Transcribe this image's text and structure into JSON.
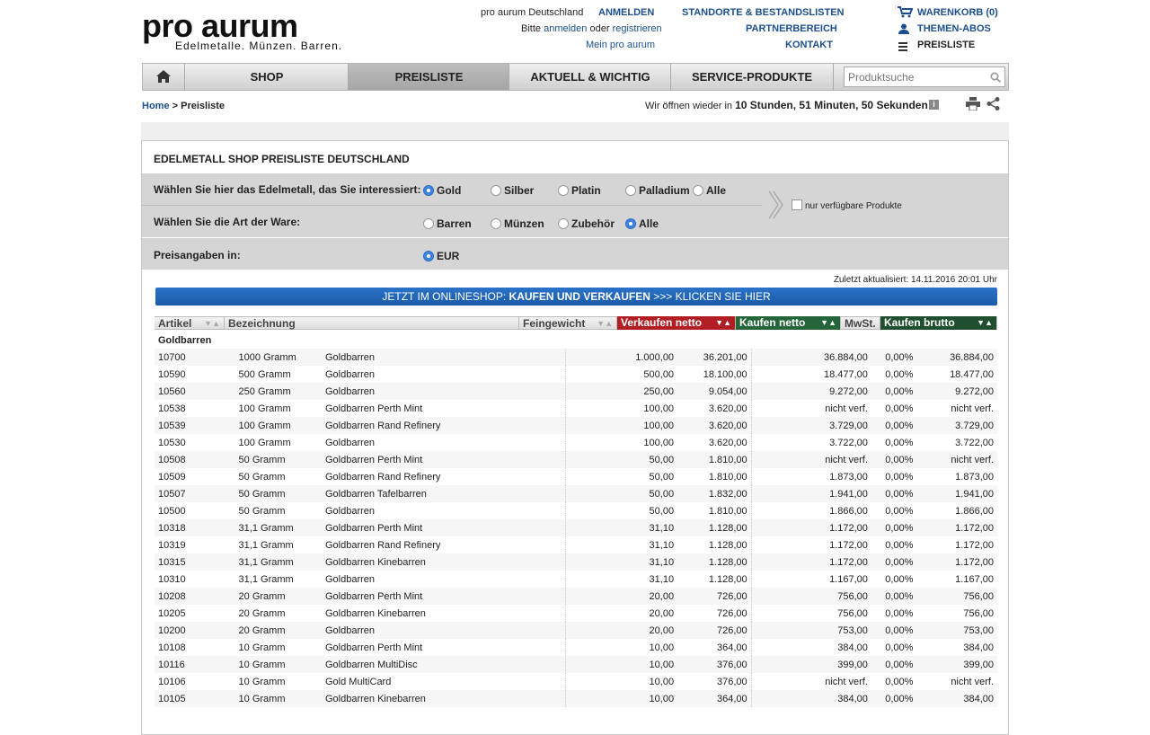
{
  "logo": {
    "title": "pro aurum",
    "subtitle": "Edelmetalle. Münzen. Barren."
  },
  "top": {
    "country": "pro aurum Deutschland",
    "login": "ANMELDEN",
    "bitte": "Bitte",
    "anmelden": "anmelden",
    "oder": "oder",
    "registrieren": "registrieren",
    "mein": "Mein pro aurum",
    "standorte": "STANDORTE & BESTANDSLISTEN",
    "partner": "PARTNERBEREICH",
    "kontakt": "KONTAKT",
    "warenkorb": "WARENKORB (0)",
    "abos": "THEMEN-ABOS",
    "preisliste": "PREISLISTE"
  },
  "nav": {
    "shop": "SHOP",
    "preisliste": "PREISLISTE",
    "aktuell": "AKTUELL & WICHTIG",
    "service": "SERVICE-PRODUKTE",
    "search_placeholder": "Produktsuche"
  },
  "breadcrumb": {
    "home": "Home",
    "sep": ">",
    "current": "Preisliste"
  },
  "opening": {
    "prefix": "Wir öffnen wieder in",
    "time": "10 Stunden, 51 Minuten, 50 Sekunden",
    "suffix": "."
  },
  "panel": {
    "title": "EDELMETALL SHOP PREISLISTE DEUTSCHLAND",
    "metal_label": "Wählen Sie hier das Edelmetall, das Sie interessiert:",
    "metals": [
      "Gold",
      "Silber",
      "Platin",
      "Palladium",
      "Alle"
    ],
    "type_label": "Wählen Sie die Art der Ware:",
    "types": [
      "Barren",
      "Münzen",
      "Zubehör",
      "Alle"
    ],
    "available": "nur verfügbare Produkte",
    "currency_label": "Preisangaben in:",
    "currency": "EUR",
    "updated": "Zuletzt aktualisiert: 14.11.2016 20:01 Uhr",
    "cta_prefix": "JETZT IM ONLINESHOP:",
    "cta_bold": "KAUFEN UND VERKAUFEN",
    "cta_suffix": ">>> KLICKEN SIE HIER"
  },
  "table": {
    "headers": [
      "Artikel",
      "Bezeichnung",
      "Feingewicht",
      "Verkaufen netto",
      "Kaufen netto",
      "MwSt.",
      "Kaufen brutto"
    ],
    "group": "Goldbarren",
    "rows": [
      [
        "10700",
        "1000 Gramm",
        "Goldbarren",
        "1.000,00",
        "36.201,00",
        "36.884,00",
        "0,00%",
        "36.884,00"
      ],
      [
        "10590",
        "500 Gramm",
        "Goldbarren",
        "500,00",
        "18.100,00",
        "18.477,00",
        "0,00%",
        "18.477,00"
      ],
      [
        "10560",
        "250 Gramm",
        "Goldbarren",
        "250,00",
        "9.054,00",
        "9.272,00",
        "0,00%",
        "9.272,00"
      ],
      [
        "10538",
        "100 Gramm",
        "Goldbarren Perth Mint",
        "100,00",
        "3.620,00",
        "nicht verf.",
        "0,00%",
        "nicht verf."
      ],
      [
        "10539",
        "100 Gramm",
        "Goldbarren Rand Refinery",
        "100,00",
        "3.620,00",
        "3.729,00",
        "0,00%",
        "3.729,00"
      ],
      [
        "10530",
        "100 Gramm",
        "Goldbarren",
        "100,00",
        "3.620,00",
        "3.722,00",
        "0,00%",
        "3.722,00"
      ],
      [
        "10508",
        "50 Gramm",
        "Goldbarren Perth Mint",
        "50,00",
        "1.810,00",
        "nicht verf.",
        "0,00%",
        "nicht verf."
      ],
      [
        "10509",
        "50 Gramm",
        "Goldbarren Rand Refinery",
        "50,00",
        "1.810,00",
        "1.873,00",
        "0,00%",
        "1.873,00"
      ],
      [
        "10507",
        "50 Gramm",
        "Goldbarren Tafelbarren",
        "50,00",
        "1.832,00",
        "1.941,00",
        "0,00%",
        "1.941,00"
      ],
      [
        "10500",
        "50 Gramm",
        "Goldbarren",
        "50,00",
        "1.810,00",
        "1.866,00",
        "0,00%",
        "1.866,00"
      ],
      [
        "10318",
        "31,1 Gramm",
        "Goldbarren Perth Mint",
        "31,10",
        "1.128,00",
        "1.172,00",
        "0,00%",
        "1.172,00"
      ],
      [
        "10319",
        "31,1 Gramm",
        "Goldbarren Rand Refinery",
        "31,10",
        "1.128,00",
        "1.172,00",
        "0,00%",
        "1.172,00"
      ],
      [
        "10315",
        "31,1 Gramm",
        "Goldbarren Kinebarren",
        "31,10",
        "1.128,00",
        "1.172,00",
        "0,00%",
        "1.172,00"
      ],
      [
        "10310",
        "31,1 Gramm",
        "Goldbarren",
        "31,10",
        "1.128,00",
        "1.167,00",
        "0,00%",
        "1.167,00"
      ],
      [
        "10208",
        "20 Gramm",
        "Goldbarren Perth Mint",
        "20,00",
        "726,00",
        "756,00",
        "0,00%",
        "756,00"
      ],
      [
        "10205",
        "20 Gramm",
        "Goldbarren Kinebarren",
        "20,00",
        "726,00",
        "756,00",
        "0,00%",
        "756,00"
      ],
      [
        "10200",
        "20 Gramm",
        "Goldbarren",
        "20,00",
        "726,00",
        "753,00",
        "0,00%",
        "753,00"
      ],
      [
        "10108",
        "10 Gramm",
        "Goldbarren Perth Mint",
        "10,00",
        "364,00",
        "384,00",
        "0,00%",
        "384,00"
      ],
      [
        "10116",
        "10 Gramm",
        "Goldbarren MultiDisc",
        "10,00",
        "376,00",
        "399,00",
        "0,00%",
        "399,00"
      ],
      [
        "10106",
        "10 Gramm",
        "Gold MultiCard",
        "10,00",
        "376,00",
        "nicht verf.",
        "0,00%",
        "nicht verf."
      ],
      [
        "10105",
        "10 Gramm",
        "Goldbarren Kinebarren",
        "10,00",
        "364,00",
        "384,00",
        "0,00%",
        "384,00"
      ]
    ]
  }
}
